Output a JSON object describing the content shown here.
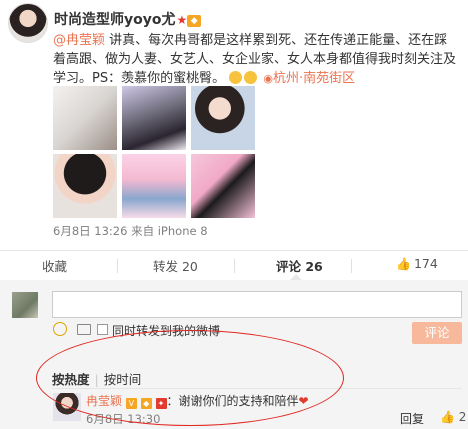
{
  "post": {
    "author": "时尚造型师yoyo尤",
    "author_star": "★",
    "mention": "@冉莹颖",
    "text": " 讲真、每次冉哥都是这样累到死、还在传递正能量、还在踩着高跟、做为人妻、女艺人、女企业家、女人本身都值得我时刻关注及学习。PS：羡慕你的蜜桃臀。",
    "location": "杭州·南苑街区",
    "meta": "6月8日 13:26 来自 iPhone 8"
  },
  "actions": {
    "collect": "收藏",
    "repost": "转发 20",
    "comment": "评论 26",
    "like": "174"
  },
  "comment_box": {
    "placeholder": "",
    "also_repost_label": "同时转发到我的微博",
    "submit_label": "评论"
  },
  "sort": {
    "hot": "按热度",
    "separator": "|",
    "time": "按时间"
  },
  "comment": {
    "name": "冉莹颖",
    "text": "：谢谢你们的支持和陪伴",
    "time": "6月8日 13:30",
    "reply_label": "回复",
    "like_count": "2"
  },
  "colors": {
    "accent": "#eb7350",
    "highlight_ring": "#e0261f",
    "submit_bg": "#f7b89b"
  }
}
